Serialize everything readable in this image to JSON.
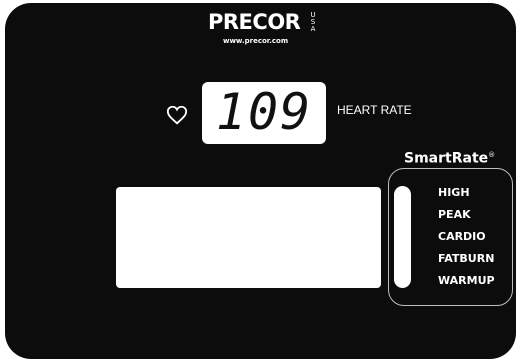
{
  "brand": {
    "name": "PRECOR",
    "country": "USA",
    "url": "www.precor.com"
  },
  "heart_rate": {
    "value": "109",
    "label": "HEART RATE",
    "icon": "heart-icon"
  },
  "smartrate": {
    "title": "SmartRate",
    "mark": "®",
    "zones": [
      "HIGH",
      "PEAK",
      "CARDIO",
      "FATBURN",
      "WARMUP"
    ]
  },
  "colors": {
    "console": "#0c0c0c",
    "display": "#ffffff",
    "text": "#ffffff"
  }
}
